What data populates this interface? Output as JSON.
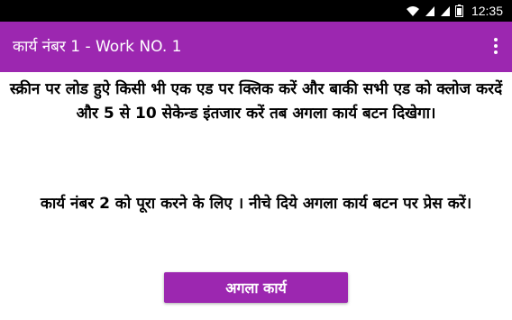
{
  "status_bar": {
    "time": "12:35",
    "icons": [
      "wifi-icon",
      "signal-icon",
      "signal-icon",
      "battery-icon"
    ]
  },
  "app_bar": {
    "title": "कार्य नंबर 1 - Work NO. 1",
    "menu_icon": "more-vert-icon"
  },
  "content": {
    "instruction": "स्क्रीन पर लोड हुऐ किसी भी एक एड पर क्लिक करें और बाकी सभी एड को क्लोज करदें और 5 से 10 सेकेन्ड इंतजार करें तब अगला कार्य बटन दिखेगा।",
    "task_note": "कार्य नंबर 2 को पूरा करने के लिए । नीचे दिये अगला कार्य बटन पर प्रेस करें।"
  },
  "next_button": {
    "label": "अगला कार्य"
  },
  "colors": {
    "app_bar": "#9c27b0",
    "status_bar": "#000000",
    "button": "#9c27b0"
  }
}
